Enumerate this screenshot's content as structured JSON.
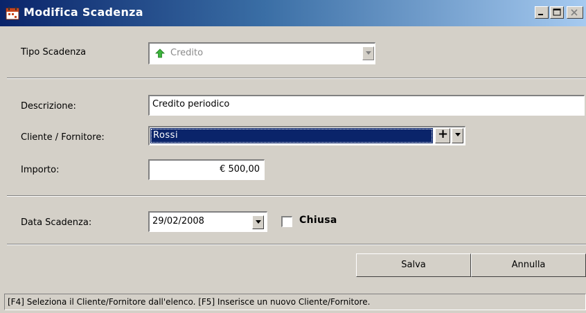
{
  "window": {
    "title": "Modifica Scadenza"
  },
  "form": {
    "tipo_scadenza": {
      "label": "Tipo Scadenza",
      "value": "Credito",
      "icon": "green-arrow-up-icon"
    },
    "descrizione": {
      "label": "Descrizione:",
      "value": "Credito periodico"
    },
    "cliente_fornitore": {
      "label": "Cliente / Fornitore:",
      "value": "Rossi",
      "add_glyph": "+"
    },
    "importo": {
      "label": "Importo:",
      "value": "€ 500,00"
    },
    "data_scadenza": {
      "label": "Data Scadenza:",
      "value": "29/02/2008"
    },
    "chiusa": {
      "label": "Chiusa",
      "checked": false
    }
  },
  "buttons": {
    "salva": "Salva",
    "annulla": "Annulla"
  },
  "statusbar": {
    "text": "[F4] Seleziona il Cliente/Fornitore dall'elenco.  [F5] Inserisce un nuovo Cliente/Fornitore."
  },
  "colors": {
    "title_bar": "#0a246a",
    "selection": "#0a246a",
    "face": "#d4d0c8"
  }
}
